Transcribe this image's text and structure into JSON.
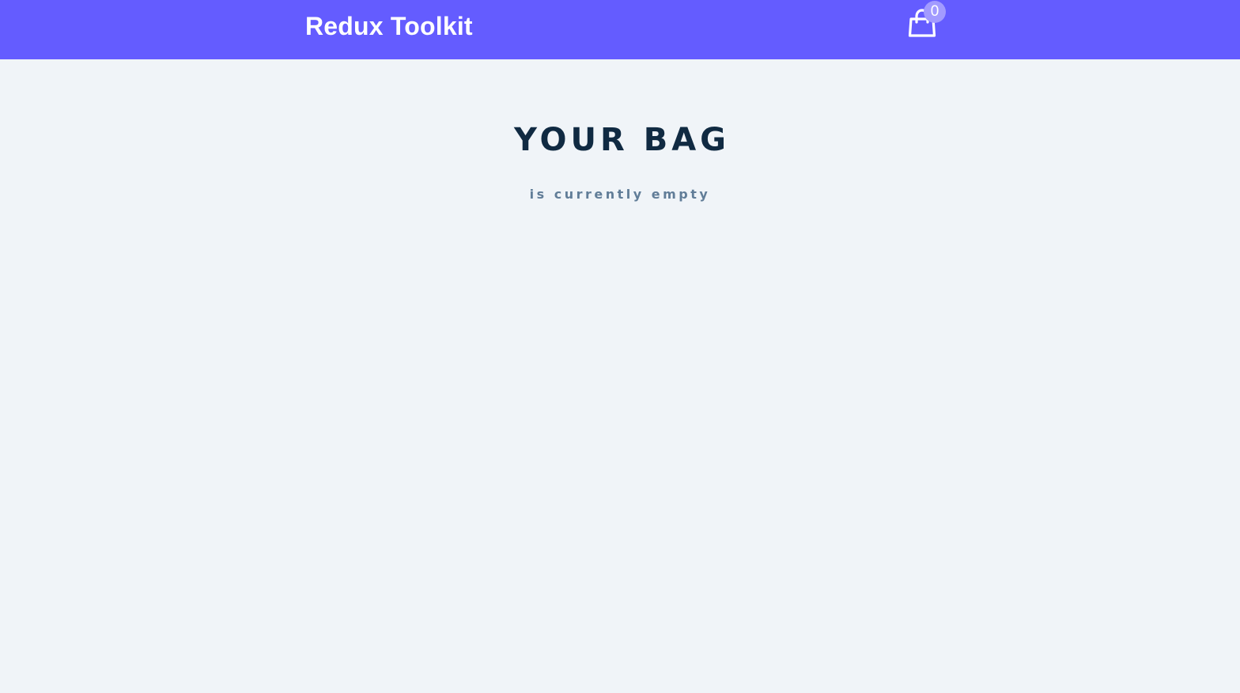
{
  "navbar": {
    "brand": "Redux Toolkit",
    "cart_icon": "shopping-bag-icon",
    "cart_amount": "0"
  },
  "cart": {
    "title": "YOUR BAG",
    "empty_message": "is currently empty"
  },
  "colors": {
    "navbar_background": "#645cff",
    "page_background": "#f0f4f8",
    "badge_background": "#a29bff",
    "title_color": "#102a42",
    "subtitle_color": "#617d98"
  }
}
